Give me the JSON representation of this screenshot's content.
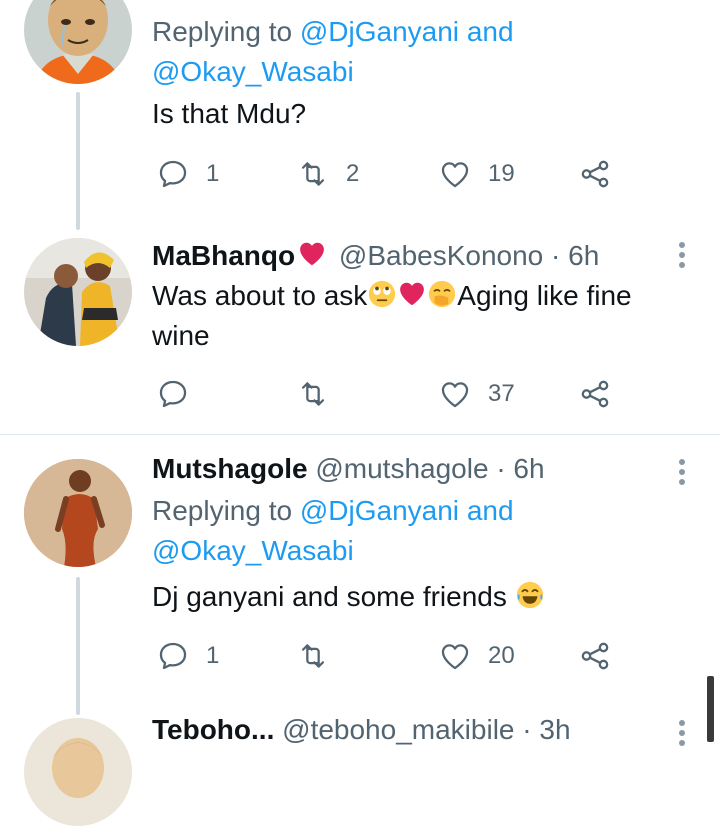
{
  "tweets": [
    {
      "reply_prefix": "Replying to",
      "mention_1": "@DjGanyani",
      "and_word": "and",
      "mention_2": "@Okay_Wasabi",
      "text": "Is that Mdu?",
      "replies": "1",
      "retweets": "2",
      "likes": "19"
    },
    {
      "name": "MaBhanqo",
      "handle": "@BabesKonono",
      "separator": "·",
      "time": "6h",
      "text_a": "Was about to ask",
      "text_b": "Aging like fine wine",
      "replies": "",
      "retweets": "",
      "likes": "37"
    },
    {
      "name": "Mutshagole",
      "handle": "@mutshagole",
      "separator": "·",
      "time": "6h",
      "reply_prefix": "Replying to",
      "mention_1": "@DjGanyani",
      "and_word": "and",
      "mention_2": "@Okay_Wasabi",
      "text": "Dj ganyani and some friends",
      "replies": "1",
      "retweets": "",
      "likes": "20"
    },
    {
      "name": "Teboho...",
      "handle": "@teboho_makibile",
      "separator": "·",
      "time": "3h"
    }
  ],
  "icons": {
    "reply": "reply-bubble-icon",
    "retweet": "retweet-icon",
    "like": "heart-outline-icon",
    "share": "share-icon",
    "more": "more-vertical-icon"
  },
  "colors": {
    "mention": "#1d9bf0",
    "secondary_text": "#536471",
    "primary_text": "#0f1419",
    "thread_line": "#cfd9de",
    "heart_emoji": "#e0245e"
  }
}
